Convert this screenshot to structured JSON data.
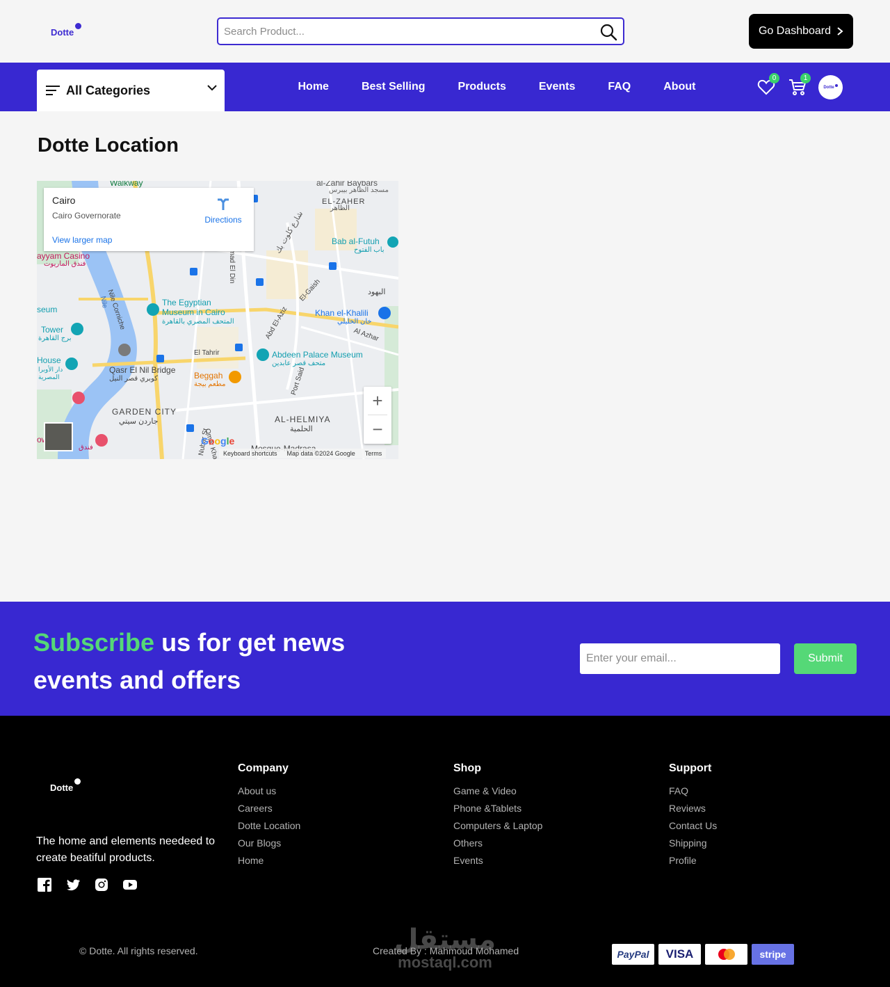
{
  "brand": {
    "name": "Dotte",
    "color": "#3d2bd1"
  },
  "search": {
    "placeholder": "Search Product..."
  },
  "header": {
    "dashboard_label": "Go Dashboard"
  },
  "nav": {
    "categories_label": "All Categories",
    "links": [
      "Home",
      "Best Selling",
      "Products",
      "Events",
      "FAQ",
      "About"
    ],
    "wishlist_count": "0",
    "cart_count": "1",
    "avatar_text": "Dotte",
    "bg_color": "#3828d1"
  },
  "main": {
    "title": "Dotte Location",
    "map": {
      "place": "Cairo",
      "region": "Cairo Governorate",
      "directions": "Directions",
      "view_larger": "View larger map",
      "zoom_in": "+",
      "zoom_out": "−",
      "google": "Google",
      "attribution": [
        "Keyboard shortcuts",
        "Map data ©2024 Google",
        "Terms"
      ],
      "labels": {
        "walkway": "Walkway",
        "zahir_baybars": "al-Zahir Baybars",
        "zahir_baybars_ar": "مسجد الظاهر بيبرس",
        "el_zaher": "EL-ZAHER",
        "el_zaher_ar": "الظاهر",
        "bab_futuh": "Bab al-Futuh",
        "bab_futuh_ar": "باب الفتوح",
        "casino": "ayyam Casino",
        "casino_ar": "فندق الماريوت",
        "nile_corniche": "Nile Corniche",
        "nile": "Nile",
        "museum_1": "The Egyptian",
        "museum_2": "Museum in Cairo",
        "museum_ar": "المتحف المصري بالقاهرة",
        "khan": "Khan el-Khalili",
        "khan_ar": "خان الخليلي",
        "al_yahud": "البهود",
        "seum": "seum",
        "tower": "Tower",
        "tower_ar": "برج القاهرة",
        "house": "House",
        "house_ar": "دار الأوبرا المصرية",
        "qasr_bridge": "Qasr El Nil Bridge",
        "qasr_bridge_ar": "كوبري قصر النيل",
        "abdeen": "Abdeen Palace Museum",
        "abdeen_ar": "متحف قصر عابدين",
        "beggah": "Beggah",
        "beggah_ar": "مطعم بيجة",
        "garden_city": "GARDEN CITY",
        "garden_city_ar": "جاردن سيتي",
        "helmiya": "AL-HELMIYA",
        "helmiya_ar": "الحلمية",
        "mosque": "Mosque-Madrasa",
        "tower_bottom": "ower",
        "tower_bottom_ar": "فندق",
        "el_tahrir": "El Tahrir",
        "emad_el_din": "Emad El Din",
        "el_gaish": "El-Gaish",
        "abd_el_aziz": "Abd El-Aziz",
        "al_azhar": "Al Azhar",
        "port_said": "Port Said",
        "nubar": "Nubar St",
        "omar": "Omar Khai",
        "clot_bey_ar": "شارع كلوت بك"
      }
    }
  },
  "subscribe": {
    "accent_word": "Subscribe",
    "rest_line1": "us for get news",
    "line2": "events and offers",
    "email_placeholder": "Enter your email...",
    "submit_label": "Submit",
    "accent_color": "#55d877"
  },
  "footer": {
    "tagline": "The home and elements needeed to create beatiful products.",
    "socials": [
      "facebook-icon",
      "twitter-icon",
      "instagram-icon",
      "youtube-icon"
    ],
    "columns": [
      {
        "title": "Company",
        "links": [
          "About us",
          "Careers",
          "Dotte Location",
          "Our Blogs",
          "Home"
        ]
      },
      {
        "title": "Shop",
        "links": [
          "Game & Video",
          "Phone &Tablets",
          "Computers & Laptop",
          "Others",
          "Events"
        ]
      },
      {
        "title": "Support",
        "links": [
          "FAQ",
          "Reviews",
          "Contact Us",
          "Shipping",
          "Profile"
        ]
      }
    ],
    "copyright": "© Dotte. All rights reserved.",
    "created_by": "Created By : Mahmoud Mohamed",
    "watermark_ar": "مستقل",
    "watermark_latin": "mostaql.com",
    "payments": [
      "PayPal",
      "VISA",
      "mastercard",
      "stripe"
    ]
  }
}
